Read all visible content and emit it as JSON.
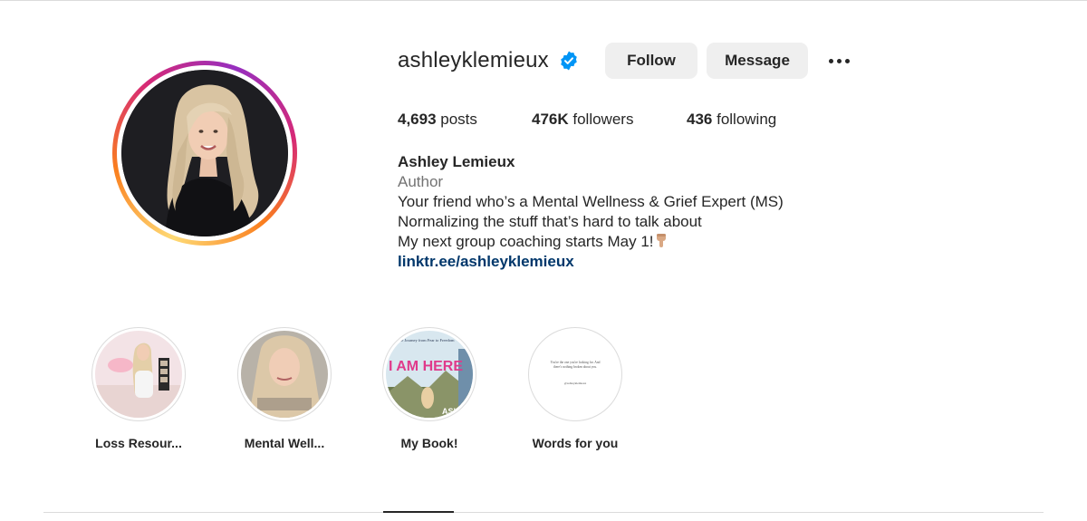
{
  "profile": {
    "username": "ashleyklemieux",
    "verified": true,
    "follow_label": "Follow",
    "message_label": "Message"
  },
  "stats": {
    "posts_count": "4,693",
    "posts_label": " posts",
    "followers_count": "476K",
    "followers_label": " followers",
    "following_count": "436",
    "following_label": " following"
  },
  "bio": {
    "name": "Ashley Lemieux",
    "category": "Author",
    "lines": [
      "Your friend who’s a Mental Wellness & Grief Expert (MS)",
      "Normalizing the stuff that’s hard to talk about",
      "My next group coaching starts May 1!"
    ],
    "link": "linktr.ee/ashleyklemieux"
  },
  "highlights": [
    {
      "label": "Loss Resour..."
    },
    {
      "label": "Mental Well..."
    },
    {
      "label": "My Book!",
      "cover_text": "I AM HERE",
      "cover_tagline": "The Journey from Fear to Freedom",
      "cover_author": "ASHL"
    },
    {
      "label": "Words for you",
      "cover_text": "You're the one you're looking for. And there's nothing broken about you.",
      "cover_sig": "@ashleyklemieux"
    }
  ],
  "colors": {
    "text": "#262626",
    "muted": "#737373",
    "link": "#00376b",
    "button_bg": "#efefef",
    "verified": "#0095f6",
    "divider": "#dbdbdb"
  },
  "icons": {
    "verified": "verified-badge-icon",
    "more": "more-options-icon",
    "emoji": "pointing-down-emoji"
  }
}
